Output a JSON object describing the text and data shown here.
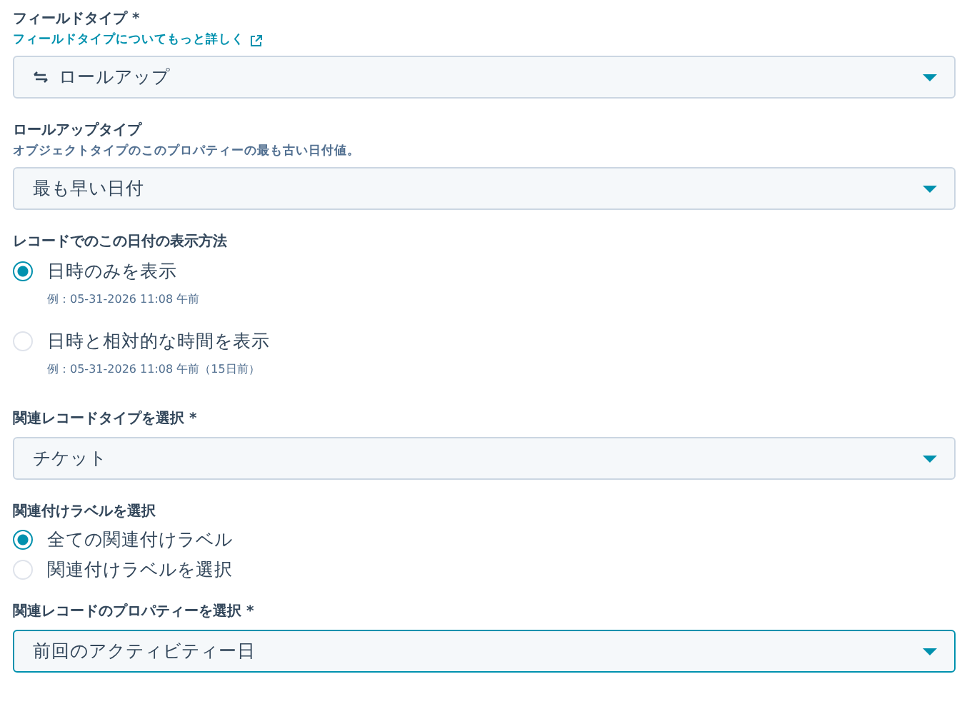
{
  "sections": [
    {
      "kind": "select",
      "label": "フィールドタイプ *",
      "link": "フィールドタイプについてもっと詳しく",
      "value": "ロールアップ",
      "icon": true,
      "focused": false
    },
    {
      "kind": "select",
      "label": "ロールアップタイプ",
      "help": "オブジェクトタイプのこのプロパティーの最も古い日付値。",
      "value": "最も早い日付",
      "focused": false
    },
    {
      "kind": "radio",
      "label": "レコードでのこの日付の表示方法",
      "options": [
        {
          "label": "日時のみを表示",
          "hint": "例：05-31-2026 11:08 午前",
          "selected": true
        },
        {
          "label": "日時と相対的な時間を表示",
          "hint": "例：05-31-2026 11:08 午前（15日前）",
          "selected": false
        }
      ]
    },
    {
      "kind": "select",
      "label": "関連レコードタイプを選択 *",
      "value": "チケット",
      "focused": false
    },
    {
      "kind": "radio",
      "label": "関連付けラベルを選択",
      "options": [
        {
          "label": "全ての関連付けラベル",
          "selected": true
        },
        {
          "label": "関連付けラベルを選択",
          "selected": false
        }
      ]
    },
    {
      "kind": "select",
      "label": "関連レコードのプロパティーを選択 *",
      "value": "前回のアクティビティー日",
      "focused": true
    }
  ]
}
